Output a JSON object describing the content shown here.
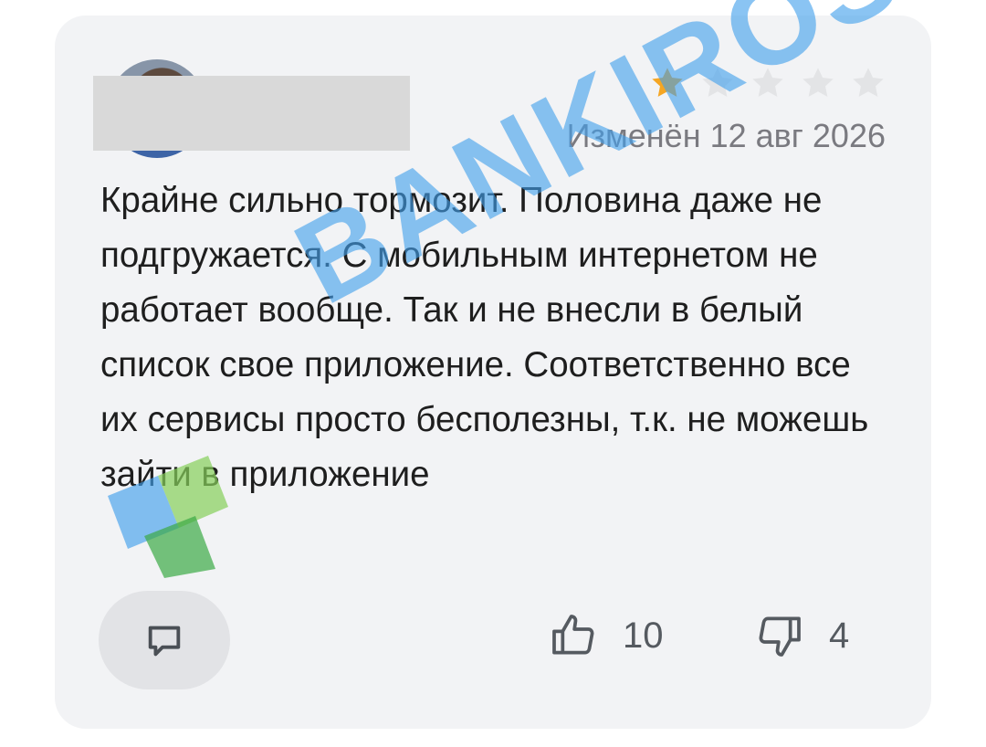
{
  "review": {
    "rating": 1,
    "max_rating": 5,
    "date": "Изменён 12 авг 2026",
    "text": "Крайне сильно тормозит. Половина даже не подгружается. С мобильным интернетом не работает вообще. Так и не внесли в белый список свое приложение. Соответственно все их сервисы просто бесполезны, т.к. не можешь зайти в приложение",
    "likes": "10",
    "dislikes": "4"
  },
  "icons": {
    "reply": "comment-icon",
    "like": "thumbs-up-icon",
    "dislike": "thumbs-down-icon"
  },
  "colors": {
    "star_filled": "#f5a623",
    "star_empty": "#e3e4e6",
    "card_bg": "#f2f3f5"
  },
  "watermark": "BANKIROS"
}
